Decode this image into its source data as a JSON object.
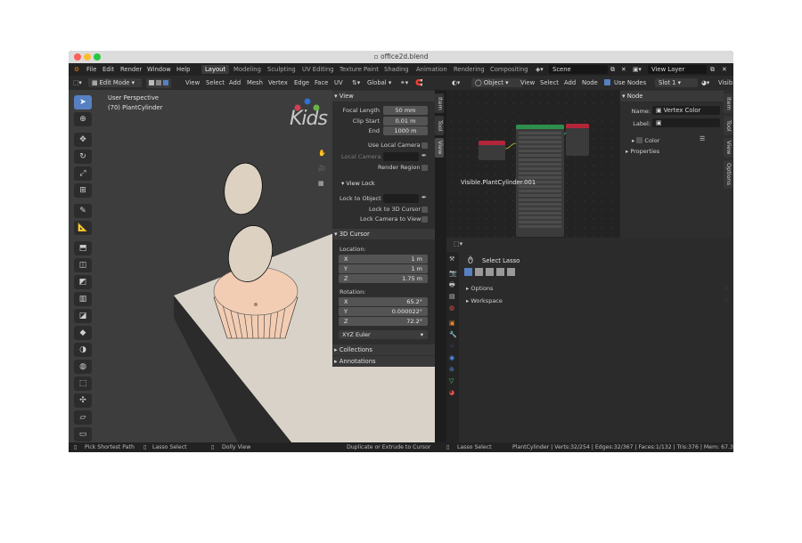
{
  "window": {
    "title": "office2d.blend"
  },
  "menubar": {
    "menus": [
      "File",
      "Edit",
      "Render",
      "Window",
      "Help"
    ],
    "workspaces": [
      "Layout",
      "Modeling",
      "Sculpting",
      "UV Editing",
      "Texture Paint",
      "Shading",
      "Animation",
      "Rendering",
      "Compositing"
    ],
    "active_workspace": "Layout",
    "scene": "Scene",
    "view_layer": "View Layer"
  },
  "viewport_header": {
    "mode": "Edit Mode",
    "menus": [
      "View",
      "Select",
      "Add",
      "Mesh",
      "Vertex",
      "Edge",
      "Face",
      "UV"
    ],
    "orientation": "Global"
  },
  "viewport": {
    "perspective": "User Perspective",
    "object": "(70) PlantCylinder",
    "watermark": "Kids"
  },
  "npanel": {
    "tabs": [
      "Item",
      "Tool",
      "View"
    ],
    "view_header": "View",
    "focal_length_label": "Focal Length",
    "focal_length": "50 mm",
    "clip_start_label": "Clip Start",
    "clip_start": "0.01 m",
    "end_label": "End",
    "end": "1000 m",
    "use_local_camera": "Use Local Camera",
    "local_camera": "Local Camera",
    "render_region": "Render Region",
    "view_lock_header": "View Lock",
    "lock_to_object": "Lock to Object",
    "lock_to_3d_cursor": "Lock to 3D Cursor",
    "lock_camera_to_view": "Lock Camera to View",
    "cursor_header": "3D Cursor",
    "location_label": "Location:",
    "loc_x_label": "X",
    "loc_x": "1 m",
    "loc_y_label": "Y",
    "loc_y": "1 m",
    "loc_z_label": "Z",
    "loc_z": "1.75 m",
    "rotation_label": "Rotation:",
    "rot_x_label": "X",
    "rot_x": "65.2°",
    "rot_y_label": "Y",
    "rot_y": "0.000022°",
    "rot_z_label": "Z",
    "rot_z": "72.2°",
    "rotation_mode": "XYZ Euler",
    "collections": "Collections",
    "annotations": "Annotations"
  },
  "node_editor_header": {
    "type": "Object",
    "menus": [
      "View",
      "Select",
      "Add",
      "Node"
    ],
    "use_nodes": "Use Nodes",
    "slot": "Slot 1",
    "visib": "Visib"
  },
  "node_editor": {
    "material_name": "Visible.PlantCylinder.001"
  },
  "node_props": {
    "tabs": [
      "Item",
      "Tool",
      "View",
      "Options"
    ],
    "header": "Node",
    "name_label": "Name:",
    "name": "Vertex Color",
    "label_label": "Label:",
    "color_label": "Color",
    "properties_label": "Properties"
  },
  "properties_editor": {
    "tool": "Select Lasso",
    "options": "Options",
    "workspace": "Workspace"
  },
  "statusbar": {
    "items": [
      "Pick Shortest Path",
      "Lasso Select",
      "Dolly View",
      "Duplicate or Extrude to Cursor",
      "Lasso Select"
    ],
    "stats": "PlantCylinder | Verts:32/254 | Edges:32/367 | Faces:1/132 | Tris:376 | Mem: 67.3"
  },
  "colors": {
    "accent": "#5680c2",
    "active_workspace_bg": "#3b3b3b",
    "viewport_bg": "#3d3d3d",
    "table": "#d9d2c8",
    "cupcake": "#f2cdb4"
  }
}
